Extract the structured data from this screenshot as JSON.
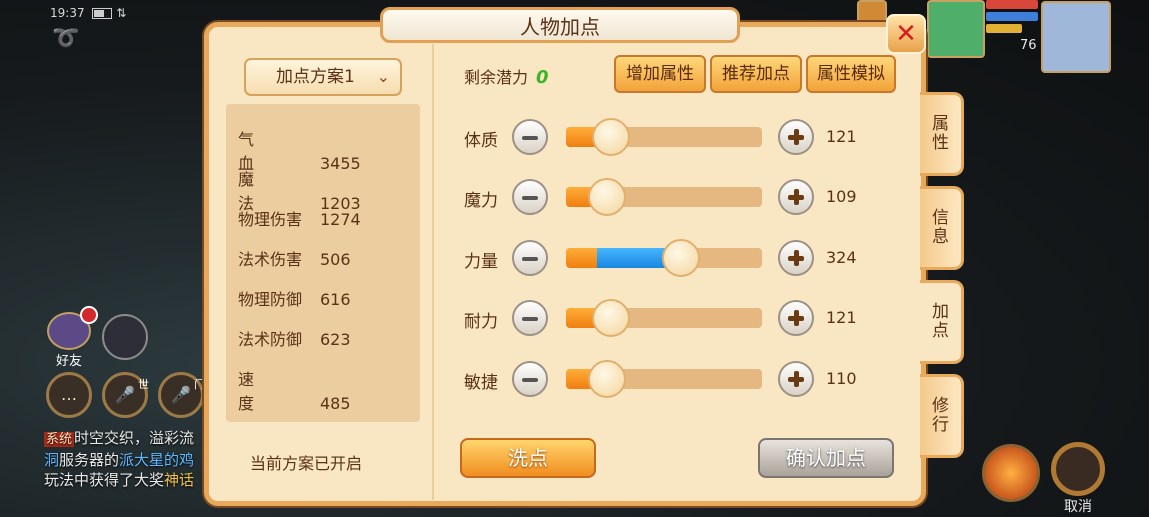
{
  "status_bar": {
    "time": "19:37"
  },
  "title": "人物加点",
  "close_icon": "close-icon",
  "scheme_dropdown": {
    "label": "加点方案1"
  },
  "stats": [
    {
      "key": "气血",
      "value": "3455"
    },
    {
      "key": "魔法",
      "value": "1203"
    },
    {
      "key": "物理伤害",
      "value": "1274"
    },
    {
      "key": "法术伤害",
      "value": "506"
    },
    {
      "key": "物理防御",
      "value": "616"
    },
    {
      "key": "法术防御",
      "value": "623"
    },
    {
      "key": "速度",
      "value": "485"
    }
  ],
  "scheme_status": "当前方案已开启",
  "potential": {
    "label": "剩余潜力",
    "value": "0"
  },
  "top_buttons": {
    "add": "增加属性",
    "recommend": "推荐加点",
    "simulate": "属性模拟"
  },
  "attributes": [
    {
      "name": "体质",
      "value": "121",
      "level": 0.18,
      "pending": 0
    },
    {
      "name": "魔力",
      "value": "109",
      "level": 0.16,
      "pending": 0
    },
    {
      "name": "力量",
      "value": "324",
      "level": 0.16,
      "pending": 0.48
    },
    {
      "name": "耐力",
      "value": "121",
      "level": 0.18,
      "pending": 0
    },
    {
      "name": "敏捷",
      "value": "110",
      "level": 0.16,
      "pending": 0
    }
  ],
  "wash_button": "洗点",
  "confirm_button": "确认加点",
  "side_tabs": [
    "属性",
    "信息",
    "加点",
    "修行"
  ],
  "active_tab": "加点",
  "hud": {
    "level": "76",
    "cancel_label": "取消",
    "friend_label": "好友"
  },
  "chat": {
    "tag": "系统",
    "line1": "时空交织，溢彩流",
    "line2_a": "洞",
    "line2_b": "服务器的",
    "line2_c": "派大星的鸡",
    "line3_a": "玩法中获得了大奖",
    "line3_b": "神话"
  },
  "colors": {
    "accent": "#f2a33a",
    "potential_value": "#3bb42a",
    "pending_fill": "#1a86e0",
    "close_x": "#d62020"
  }
}
